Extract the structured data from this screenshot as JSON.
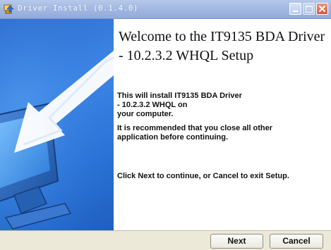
{
  "window": {
    "title": "Driver Install (0.1.4.0)",
    "icons": {
      "app": "installer-icon",
      "minimize": "minimize-icon",
      "maximize": "maximize-icon",
      "close": "close-icon"
    }
  },
  "banner": {
    "illustration": "monitor-arrow-illustration",
    "accent_color": "#2f6ed0"
  },
  "content": {
    "title": "Welcome to the IT9135 BDA Driver - 10.2.3.2 WHQL Setup",
    "paragraph1": [
      "This will install IT9135 BDA Driver",
      "- 10.2.3.2 WHQL on",
      "your computer."
    ],
    "paragraph2": [
      "It is recommended that you close all other",
      "application before continuing."
    ],
    "paragraph3": [
      "Click Next to continue, or Cancel to exit Setup."
    ]
  },
  "buttons": {
    "next": "Next",
    "cancel": "Cancel"
  }
}
